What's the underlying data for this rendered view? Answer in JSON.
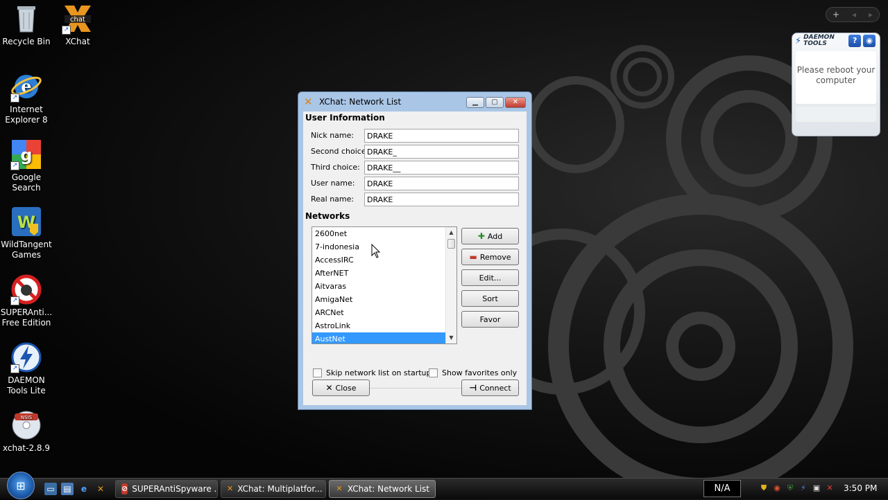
{
  "desktop": {
    "icons": [
      {
        "label": "Recycle Bin"
      },
      {
        "label": "XChat"
      },
      {
        "label": "Internet Explorer 8"
      },
      {
        "label": "Google Search"
      },
      {
        "label": "WildTangent Games"
      },
      {
        "label": "SUPERAnti... Free Edition"
      },
      {
        "label": "DAEMON Tools Lite"
      },
      {
        "label": "xchat-2.8.9"
      }
    ]
  },
  "gadget": {
    "brand": "DAEMON TOOLS",
    "message": "Please reboot your computer",
    "help": "?"
  },
  "window": {
    "title": "XChat: Network List",
    "user_info_heading": "User Information",
    "fields": [
      {
        "label": "Nick name:",
        "value": "DRAKE"
      },
      {
        "label": "Second choice:",
        "value": "DRAKE_"
      },
      {
        "label": "Third choice:",
        "value": "DRAKE__"
      },
      {
        "label": "User name:",
        "value": "DRAKE"
      },
      {
        "label": "Real name:",
        "value": "DRAKE"
      }
    ],
    "networks_heading": "Networks",
    "networks": [
      "2600net",
      "7-indonesia",
      "AccessIRC",
      "AfterNET",
      "Aitvaras",
      "AmigaNet",
      "ARCNet",
      "AstroLink",
      "AustNet"
    ],
    "selected_network": "AustNet",
    "buttons": {
      "add": "Add",
      "remove": "Remove",
      "edit": "Edit...",
      "sort": "Sort",
      "favor": "Favor",
      "close": "Close",
      "connect": "Connect"
    },
    "checkboxes": {
      "skip": "Skip network list on startup",
      "favorites": "Show favorites only"
    }
  },
  "taskbar": {
    "tasks": [
      {
        "label": "SUPERAntiSpyware ..."
      },
      {
        "label": "XChat: Multiplatfor..."
      },
      {
        "label": "XChat: Network List"
      }
    ],
    "indicator": "N/A",
    "clock": "3:50 PM"
  }
}
